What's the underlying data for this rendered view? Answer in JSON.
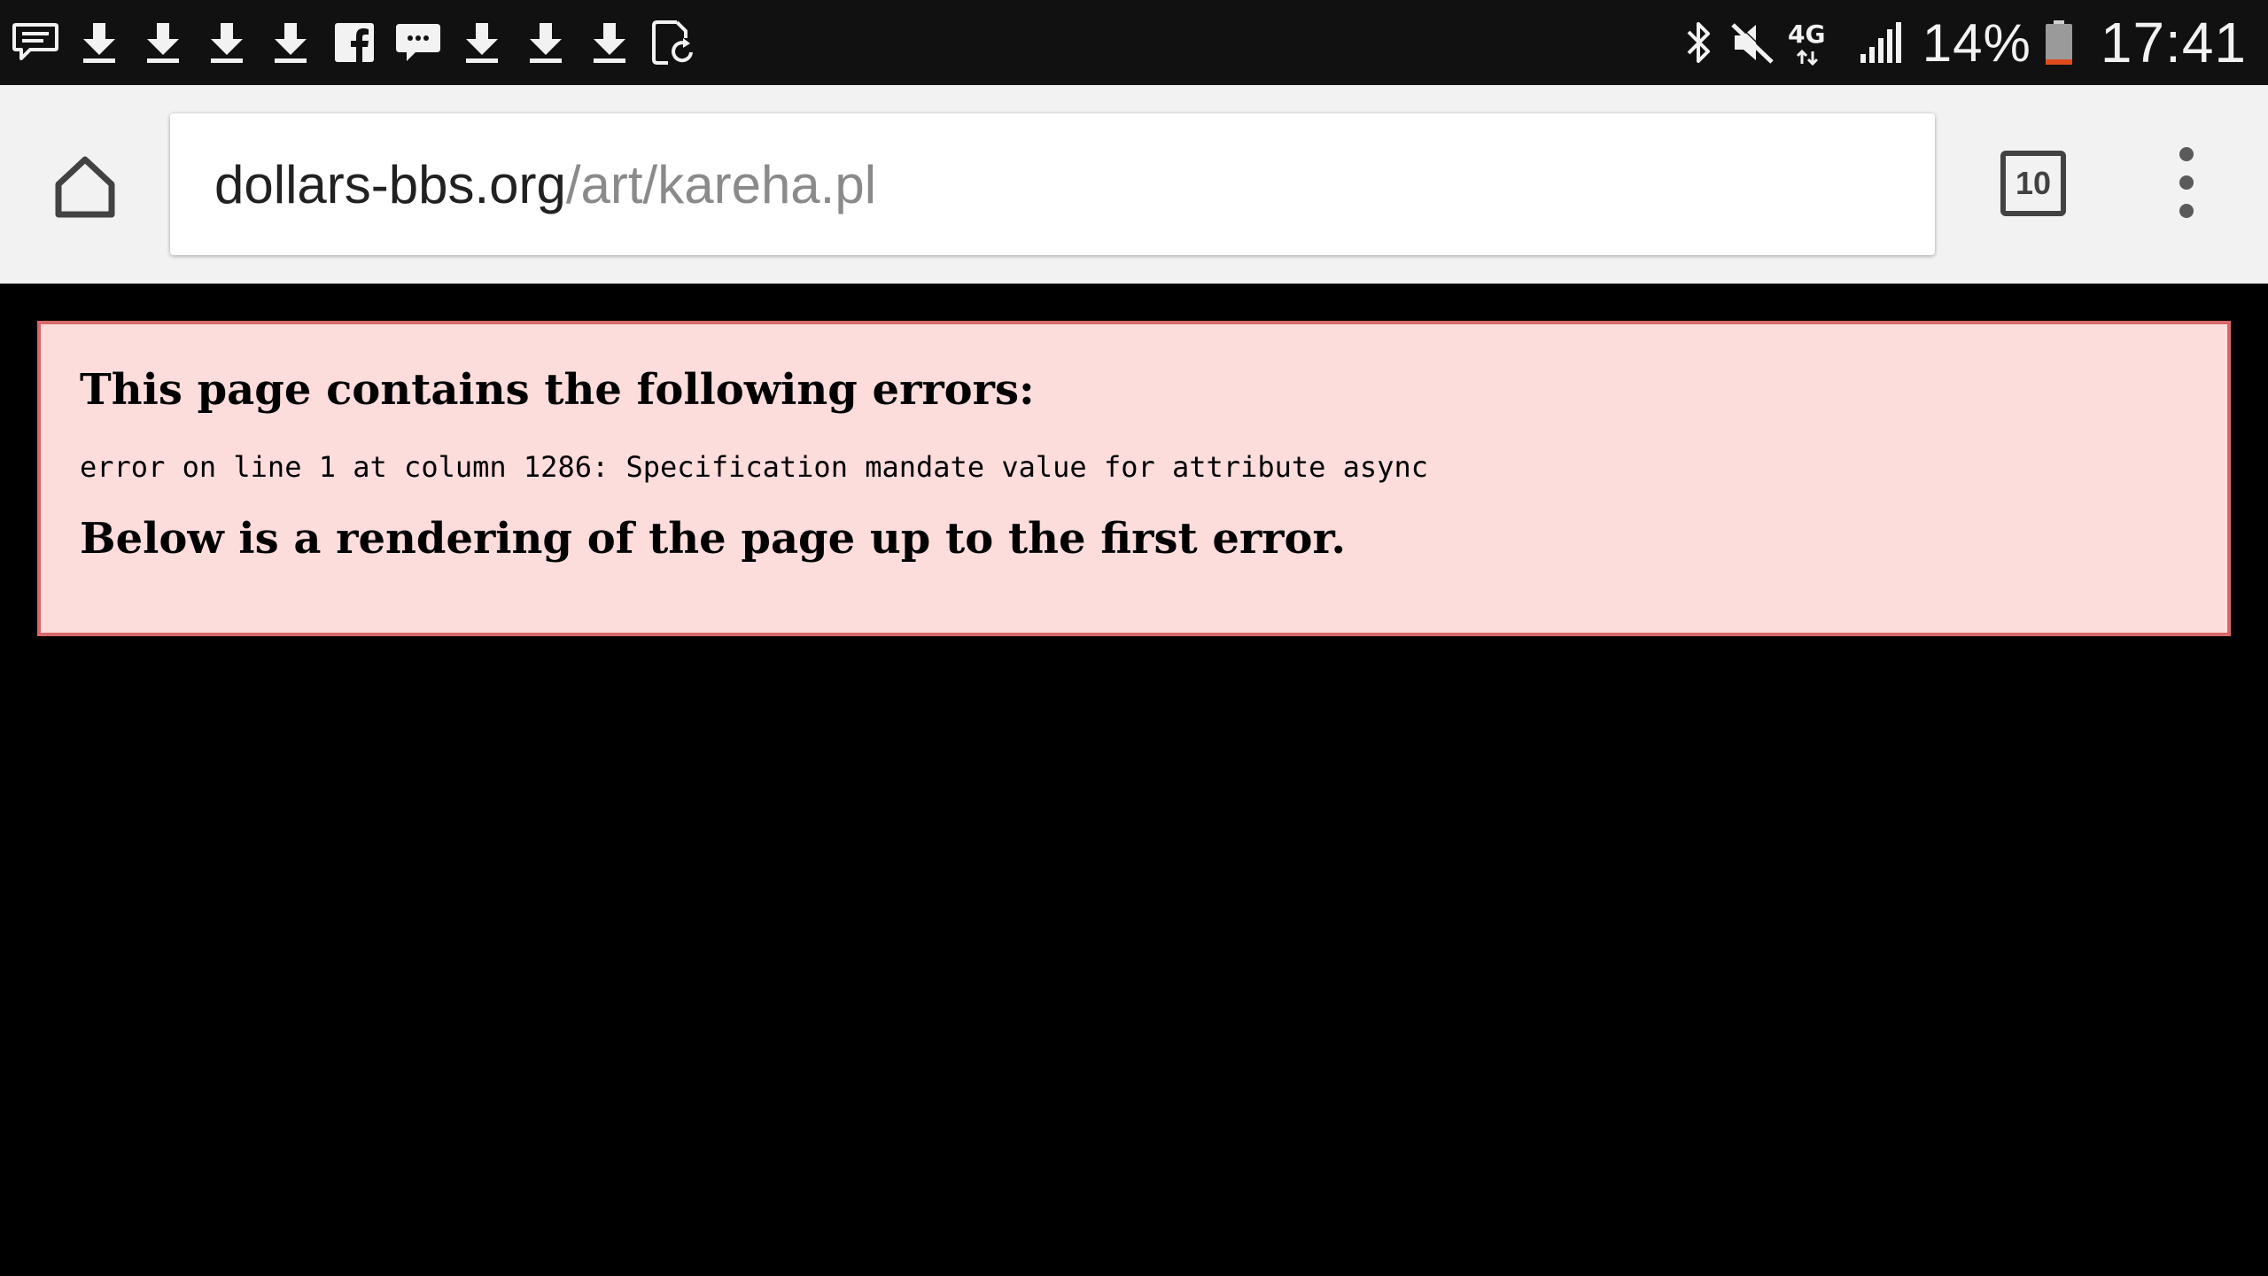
{
  "status_bar": {
    "notification_icons": [
      "message-icon",
      "download-icon",
      "download-icon",
      "download-icon",
      "download-icon",
      "facebook-icon",
      "chat-bubble-icon",
      "download-icon",
      "download-icon",
      "download-icon",
      "screen-rotate-icon"
    ],
    "system_icons": [
      "bluetooth-icon",
      "mute-icon",
      "4g-lte-icon",
      "signal-icon"
    ],
    "network_label": "4G",
    "battery_percent": "14%",
    "battery_level": 0.14,
    "time": "17:41"
  },
  "toolbar": {
    "url_domain": "dollars-bbs.org",
    "url_path": "/art/kareha.pl",
    "tab_count": "10"
  },
  "page": {
    "error_heading": "This page contains the following errors:",
    "error_detail": "error on line 1 at column 1286: Specification mandate value for attribute async",
    "error_sub": "Below is a rendering of the page up to the first error."
  },
  "colors": {
    "status_bar_bg": "#111111",
    "toolbar_bg": "#f2f2f2",
    "error_box_bg": "#fddcdc",
    "error_box_border": "#d86868",
    "page_bg": "#000000"
  }
}
